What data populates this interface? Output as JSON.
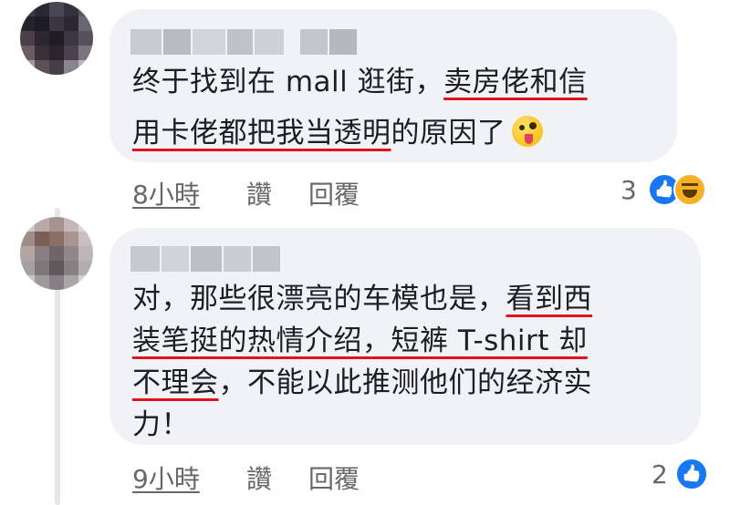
{
  "comments": [
    {
      "text_lines": [
        [
          {
            "t": "终于找到在 mall 逛街，"
          },
          {
            "t": "卖房佬和信",
            "u": true
          }
        ],
        [
          {
            "t": "用卡佬都把我当透明",
            "u": true
          },
          {
            "t": "的原因了"
          }
        ]
      ],
      "emoji": "zany-face",
      "timestamp": "8小時",
      "like_label": "讚",
      "reply_label": "回覆",
      "reaction_count": "3"
    },
    {
      "text_lines": [
        [
          {
            "t": "对，那些很漂亮的车模也是，"
          },
          {
            "t": "看到西",
            "u": true
          }
        ],
        [
          {
            "t": "装笔挺的热情介绍，短裤 T-shirt 却",
            "u": true
          }
        ],
        [
          {
            "t": "不理会",
            "u": true
          },
          {
            "t": "，不能以此推测他们的经济实"
          }
        ],
        [
          {
            "t": "力！"
          }
        ]
      ],
      "timestamp": "9小時",
      "like_label": "讚",
      "reply_label": "回覆",
      "reaction_count": "2"
    }
  ],
  "colors": {
    "bubble": "#f0f2f5",
    "underline": "#e0141e",
    "like": "#1877f2",
    "haha": "#f7b125",
    "meta_text": "#65676b"
  }
}
